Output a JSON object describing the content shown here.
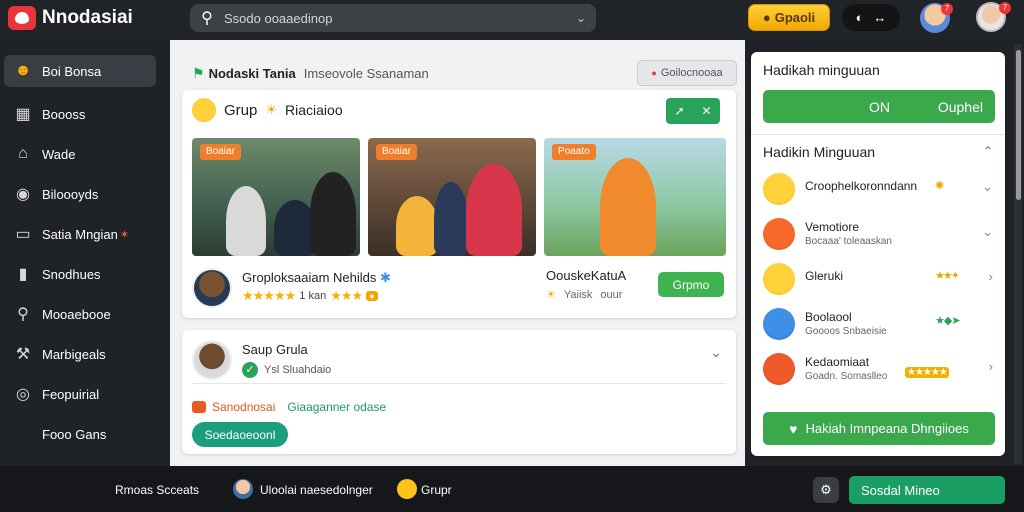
{
  "app": {
    "title": "Nnodasiai"
  },
  "search": {
    "placeholder": "Ssodo ooaaedinop"
  },
  "header": {
    "gold_button": "Gpaoli"
  },
  "sidebar": {
    "items": [
      {
        "label": "Boi Bonsa"
      },
      {
        "label": "Boooss"
      },
      {
        "label": "Wade"
      },
      {
        "label": "Biloooyds"
      },
      {
        "label": "Satia Mngian"
      },
      {
        "label": "Snodhues"
      },
      {
        "label": "Mooaebooe"
      },
      {
        "label": "Marbigeals"
      },
      {
        "label": "Feopuirial"
      },
      {
        "label": "Fooo Gans"
      }
    ]
  },
  "main": {
    "title": "Nodaski Tania",
    "subtitle": "Imseovole Ssanaman",
    "header_button": "Goilocnooaa",
    "card1": {
      "title": "Grup",
      "title_extra": "Riaciaioo",
      "thumbnails": [
        {
          "tag": "Boaiar"
        },
        {
          "tag": "Boaiar"
        },
        {
          "tag": "Poaato"
        }
      ],
      "group_name": "Groploksaaiam Nehilds",
      "rating_text": "1 kan",
      "video_name": "OouskeKatuA",
      "video_meta_a": "Yaiisk",
      "video_meta_b": "ouur",
      "action_button": "Grpmo"
    },
    "card2": {
      "title": "Saup Grula",
      "subtitle": "Ysl Sluahdaio",
      "live_label": "Sanodnosai",
      "live_status": "Giaaganner odase",
      "button": "Soedaoeoonl"
    }
  },
  "right": {
    "title": "Hadikah minguuan",
    "cta_a": "ON",
    "cta_b": "Ouphel",
    "section_title": "Hadikin Minguuan",
    "items": [
      {
        "name": "Croophelkoronndann",
        "sub": ""
      },
      {
        "name": "Vemotiore",
        "sub": "Bocaaa' toleaaskan"
      },
      {
        "name": "Gleruki",
        "sub": ""
      },
      {
        "name": "Boolaool",
        "sub": "Goooos Snbaeisie"
      },
      {
        "name": "Kedaomiaat",
        "sub": "Goadn. Somaslleo"
      }
    ],
    "bottom_button": "Hakiah Imnpeana Dhngiioes"
  },
  "bottombar": {
    "text1": "Rmoas Scceats",
    "text2": "Uloolai naesedolnger",
    "text3": "Grupr",
    "button": "Sosdal Mineo"
  }
}
